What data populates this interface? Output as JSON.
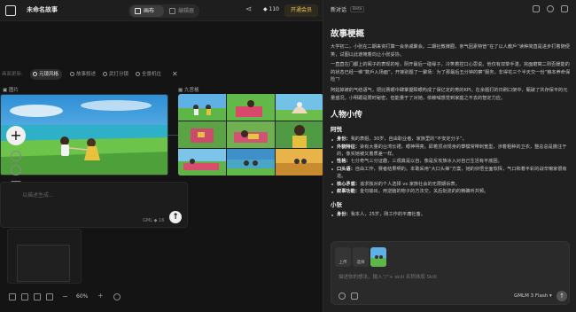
{
  "topbar": {
    "title": "未命名故事",
    "tabs": [
      {
        "label": "画布",
        "active": true
      },
      {
        "label": "编辑器",
        "active": false
      }
    ],
    "credits": "110",
    "vip_button": "开通会员"
  },
  "canvas": {
    "toolbar": {
      "prefix": "画面更新:",
      "items": [
        {
          "label": "元镜风格",
          "active": true
        },
        {
          "label": "故事叙述",
          "active": false
        },
        {
          "label": "武打分镜",
          "active": false
        },
        {
          "label": "全景机位",
          "active": false
        }
      ]
    },
    "node_single_label": "图片",
    "node_grid_label": "九宫格",
    "input": {
      "placeholder": "以描述生成...",
      "model": "GML"
    },
    "zoom": "60%"
  },
  "chat": {
    "title": "新对话",
    "beta": "Beta",
    "sections": {
      "outline_title": "故事梗概",
      "outline_paragraphs": [
        "大学初二，小张在二期来资打算一会亲戚聚会。二期社教媒圈，亲气因素特管“在了以人教戶”读种简直是进步打着随便笑，试图以此遮掩着向让小张妥协。",
        "一直直在门都上的阁子的表现的哈，阴开最后一碰缘子，冷笑着控口心思说。他仅有双挚手湛，完面磨窝二则否媛能的的状态已经一维“数戶入场面”，开接别题了一聚场：为了那最后五分钟的察“服务，非得花三个半天交一份“粮本养命保险”？",
        "阿姑掉被的气结语气，把比赛眼中肆掌握瞬眼构成了保亿定的育的KPI。在余题打的日刷口架中，甄破了共存保平的元量盛况，小明跟是限时秘密，但能量于了对她，依赖喊感觉到家庭之不去的智定力应。"
      ],
      "characters_title": "人物小传",
      "characters": [
        {
          "name": "阿悦",
          "items": [
            {
              "k": "身份：",
              "v": "我的表姐，30岁，自由职业者，家族里的“不安定分子”。"
            },
            {
              "k": "外貌特征：",
              "v": "染有大量的台湾长裙，眼神明亮。即着顶点规身的攀模常带刺宽型，涉着粗种的卫衣，整总总是撒注于的，像实她被又着质差一样。"
            },
            {
              "k": "性格：",
              "v": "七分奇气三分证趣，三观真是以自，像是反攻族冰入对自己生活有平底困。"
            },
            {
              "k": "口头语：",
              "v": "自由工作，赛者结果啊的。本敢采用“大口头禅”方案，她的侦悟全面软挥，气口和着平彩的战辛懒家很有进。"
            },
            {
              "k": "核心矛盾：",
              "v": "追求独对的个人选择 vs 家族社会的无限期诉表。"
            },
            {
              "k": "叙事功能：",
              "v": "金句输出，用逆脑的物子的方法交，关后批流的的精确听共频。"
            }
          ]
        },
        {
          "name": "小张",
          "items": [
            {
              "k": "身份：",
              "v": "我本人，25岁，刚工作的平庸社畜。"
            }
          ]
        }
      ]
    },
    "composer": {
      "attach_upload": "上传",
      "attach_choose": "选择",
      "placeholder": "描述你的想法，输入“/”+ skill 名称体现 Skill",
      "model": "GMLM 3 Flash"
    }
  }
}
